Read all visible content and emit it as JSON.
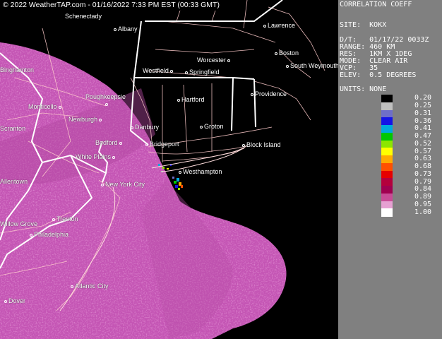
{
  "banner": "© 2022 WeatherTAP.com - 01/16/2022  7:33 PM EST (00:33 GMT)",
  "panel": {
    "product": "CORRELATION COEFF",
    "site": "SITE:  KOKX",
    "dt": "D/T:   01/17/22 0033Z",
    "range": "RANGE: 460 KM",
    "res": "RES:   1KM X 1DEG",
    "mode": "MODE:  CLEAR AIR",
    "vcp": "VCP:   35",
    "elev": "ELEV:  0.5 DEGREES",
    "units": "UNITS: NONE"
  },
  "scale": {
    "values": [
      "0.20",
      "0.25",
      "0.31",
      "0.36",
      "0.41",
      "0.47",
      "0.52",
      "0.57",
      "0.63",
      "0.68",
      "0.73",
      "0.79",
      "0.84",
      "0.89",
      "0.95",
      "1.00"
    ],
    "colors": [
      "#000000",
      "#bfbfbf",
      "#6e6ec8",
      "#1414e6",
      "#00aadc",
      "#00c800",
      "#8ce600",
      "#ffff00",
      "#ffaa00",
      "#ff5000",
      "#e60000",
      "#b4003c",
      "#a00050",
      "#c84b96",
      "#e6a0d2",
      "#ffffff"
    ]
  },
  "cities": [
    {
      "name": "Schenectady",
      "show_dot": false
    },
    {
      "name": "Albany",
      "show_dot": true
    },
    {
      "name": "Lawrence",
      "show_dot": true
    },
    {
      "name": "Boston",
      "show_dot": true
    },
    {
      "name": "Worcester",
      "show_dot": true
    },
    {
      "name": "Westfield",
      "show_dot": true
    },
    {
      "name": "Springfield",
      "show_dot": true
    },
    {
      "name": "South Weymouth",
      "show_dot": true
    },
    {
      "name": "Binghamton",
      "show_dot": false
    },
    {
      "name": "Poughkeepsie",
      "show_dot": true
    },
    {
      "name": "Hartford",
      "show_dot": true
    },
    {
      "name": "Providence",
      "show_dot": true
    },
    {
      "name": "Monticello",
      "show_dot": true
    },
    {
      "name": "Newburgh",
      "show_dot": true
    },
    {
      "name": "Danbury",
      "show_dot": true
    },
    {
      "name": "Groton",
      "show_dot": true
    },
    {
      "name": "Bedford",
      "show_dot": true
    },
    {
      "name": "Bridgeport",
      "show_dot": true
    },
    {
      "name": "Block Island",
      "show_dot": true
    },
    {
      "name": "White Plains",
      "show_dot": true
    },
    {
      "name": "Westhampton",
      "show_dot": true
    },
    {
      "name": "Allentown",
      "show_dot": false
    },
    {
      "name": "New York City",
      "show_dot": true
    },
    {
      "name": "Trenton",
      "show_dot": true
    },
    {
      "name": "Willow Grove",
      "show_dot": false
    },
    {
      "name": "Philadelphia",
      "show_dot": true
    },
    {
      "name": "Atlantic City",
      "show_dot": true
    },
    {
      "name": "Dover",
      "show_dot": true
    },
    {
      "name": "Scranton",
      "show_dot": false
    }
  ]
}
